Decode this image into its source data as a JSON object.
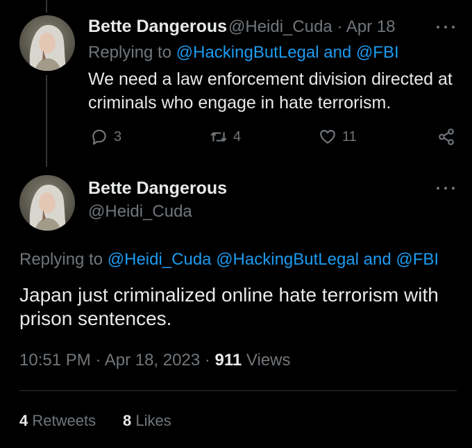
{
  "tweet1": {
    "display_name": "Bette Dangerous",
    "handle": "@Heidi_Cuda",
    "separator": "·",
    "date": "Apr 18",
    "replying_to_prefix": "Replying to",
    "replying_to_links": "@HackingButLegal and @FBI",
    "text_line1": "We need a law enforcement division directed at",
    "text_line2": "criminals who engage in hate terrorism.",
    "reply_count": "3",
    "retweet_count": "4",
    "like_count": "11"
  },
  "tweet2": {
    "display_name": "Bette Dangerous",
    "handle": "@Heidi_Cuda",
    "replying_to_prefix": "Replying to",
    "replying_to_links": "@Heidi_Cuda @HackingButLegal and @FBI",
    "text_line1": "Japan just criminalized online hate terrorism with",
    "text_line2": "prison sentences.",
    "time": "10:51 PM",
    "separator": "·",
    "date": "Apr 18, 2023",
    "views_count": "911",
    "views_label": "Views",
    "retweets_count": "4",
    "retweets_label": "Retweets",
    "likes_count": "8",
    "likes_label": "Likes"
  },
  "icons": {
    "reply": "reply-icon",
    "retweet": "retweet-icon",
    "like": "heart-icon",
    "share": "share-icon",
    "more": "more-icon"
  },
  "colors": {
    "background": "#000000",
    "text": "#e7e9ea",
    "muted": "#71767b",
    "link": "#1d9bf0",
    "divider": "#2f3336"
  }
}
